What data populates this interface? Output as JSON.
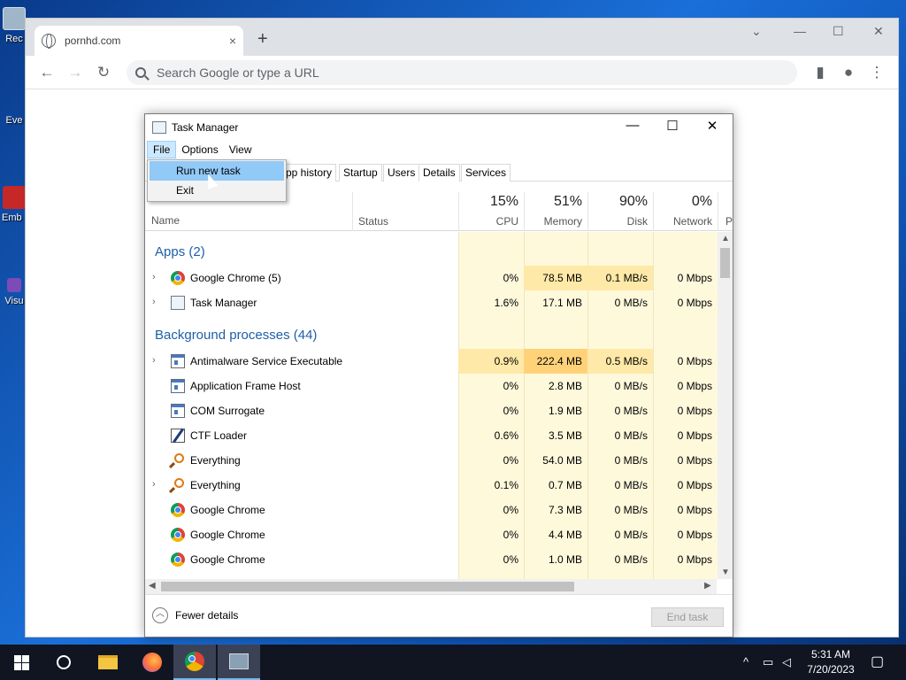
{
  "desktop": {
    "icons": [
      {
        "label": "Rec"
      },
      {
        "label": "Eve"
      },
      {
        "label": "Emb De"
      },
      {
        "label": "Visu"
      }
    ]
  },
  "chrome": {
    "tab_title": "pornhd.com",
    "tab_close": "×",
    "new_tab": "+",
    "omnibox_placeholder": "Search Google or type a URL"
  },
  "task_manager": {
    "title": "Task Manager",
    "menu": [
      "File",
      "Options",
      "View"
    ],
    "file_menu": [
      "Run new task",
      "Exit"
    ],
    "tabs": [
      "pp history",
      "Startup",
      "Users",
      "Details",
      "Services"
    ],
    "headers": {
      "name": "Name",
      "status": "Status",
      "cpu_pct": "15%",
      "cpu": "CPU",
      "memory_pct": "51%",
      "memory": "Memory",
      "disk_pct": "90%",
      "disk": "Disk",
      "network_pct": "0%",
      "network": "Network",
      "power": "P"
    },
    "groups": {
      "apps": "Apps (2)",
      "background": "Background processes (44)"
    },
    "apps": [
      {
        "name": "Google Chrome (5)",
        "icon": "chrome-icon",
        "expandable": true,
        "cpu": "0%",
        "memory": "78.5 MB",
        "disk": "0.1 MB/s",
        "network": "0 Mbps"
      },
      {
        "name": "Task Manager",
        "icon": "task-manager-icon",
        "expandable": true,
        "cpu": "1.6%",
        "memory": "17.1 MB",
        "disk": "0 MB/s",
        "network": "0 Mbps"
      }
    ],
    "background": [
      {
        "name": "Antimalware Service Executable",
        "icon": "service-app-icon",
        "expandable": true,
        "cpu": "0.9%",
        "memory": "222.4 MB",
        "disk": "0.5 MB/s",
        "network": "0 Mbps"
      },
      {
        "name": "Application Frame Host",
        "icon": "service-app-icon",
        "expandable": false,
        "cpu": "0%",
        "memory": "2.8 MB",
        "disk": "0 MB/s",
        "network": "0 Mbps"
      },
      {
        "name": "COM Surrogate",
        "icon": "service-app-icon",
        "expandable": false,
        "cpu": "0%",
        "memory": "1.9 MB",
        "disk": "0 MB/s",
        "network": "0 Mbps"
      },
      {
        "name": "CTF Loader",
        "icon": "ctf-loader-icon",
        "expandable": false,
        "cpu": "0.6%",
        "memory": "3.5 MB",
        "disk": "0 MB/s",
        "network": "0 Mbps"
      },
      {
        "name": "Everything",
        "icon": "everything-icon",
        "expandable": false,
        "cpu": "0%",
        "memory": "54.0 MB",
        "disk": "0 MB/s",
        "network": "0 Mbps"
      },
      {
        "name": "Everything",
        "icon": "everything-icon",
        "expandable": true,
        "cpu": "0.1%",
        "memory": "0.7 MB",
        "disk": "0 MB/s",
        "network": "0 Mbps"
      },
      {
        "name": "Google Chrome",
        "icon": "chrome-icon",
        "expandable": false,
        "cpu": "0%",
        "memory": "7.3 MB",
        "disk": "0 MB/s",
        "network": "0 Mbps"
      },
      {
        "name": "Google Chrome",
        "icon": "chrome-icon",
        "expandable": false,
        "cpu": "0%",
        "memory": "4.4 MB",
        "disk": "0 MB/s",
        "network": "0 Mbps"
      },
      {
        "name": "Google Chrome",
        "icon": "chrome-icon",
        "expandable": false,
        "cpu": "0%",
        "memory": "1.0 MB",
        "disk": "0 MB/s",
        "network": "0 Mbps"
      }
    ],
    "fewer_details": "Fewer details",
    "end_task": "End task"
  },
  "taskbar": {
    "time": "5:31 AM",
    "date": "7/20/2023"
  },
  "colors": {
    "heat_low": "#fff9dc",
    "heat_mid": "#ffe9a8",
    "heat_high": "#ffd27a",
    "group_blue": "#1e5fa8",
    "menu_highlight": "#91c9f7"
  }
}
